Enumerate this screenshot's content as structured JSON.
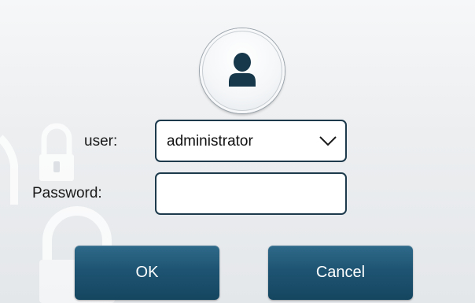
{
  "avatar": {
    "icon": "user-icon",
    "color": "#17384a"
  },
  "form": {
    "user_label": "user:",
    "user_value": "administrator",
    "password_label": "Password:",
    "password_value": ""
  },
  "buttons": {
    "ok_label": "OK",
    "cancel_label": "Cancel"
  },
  "colors": {
    "button": "#1e5472",
    "field_border": "#1d3a4c"
  }
}
